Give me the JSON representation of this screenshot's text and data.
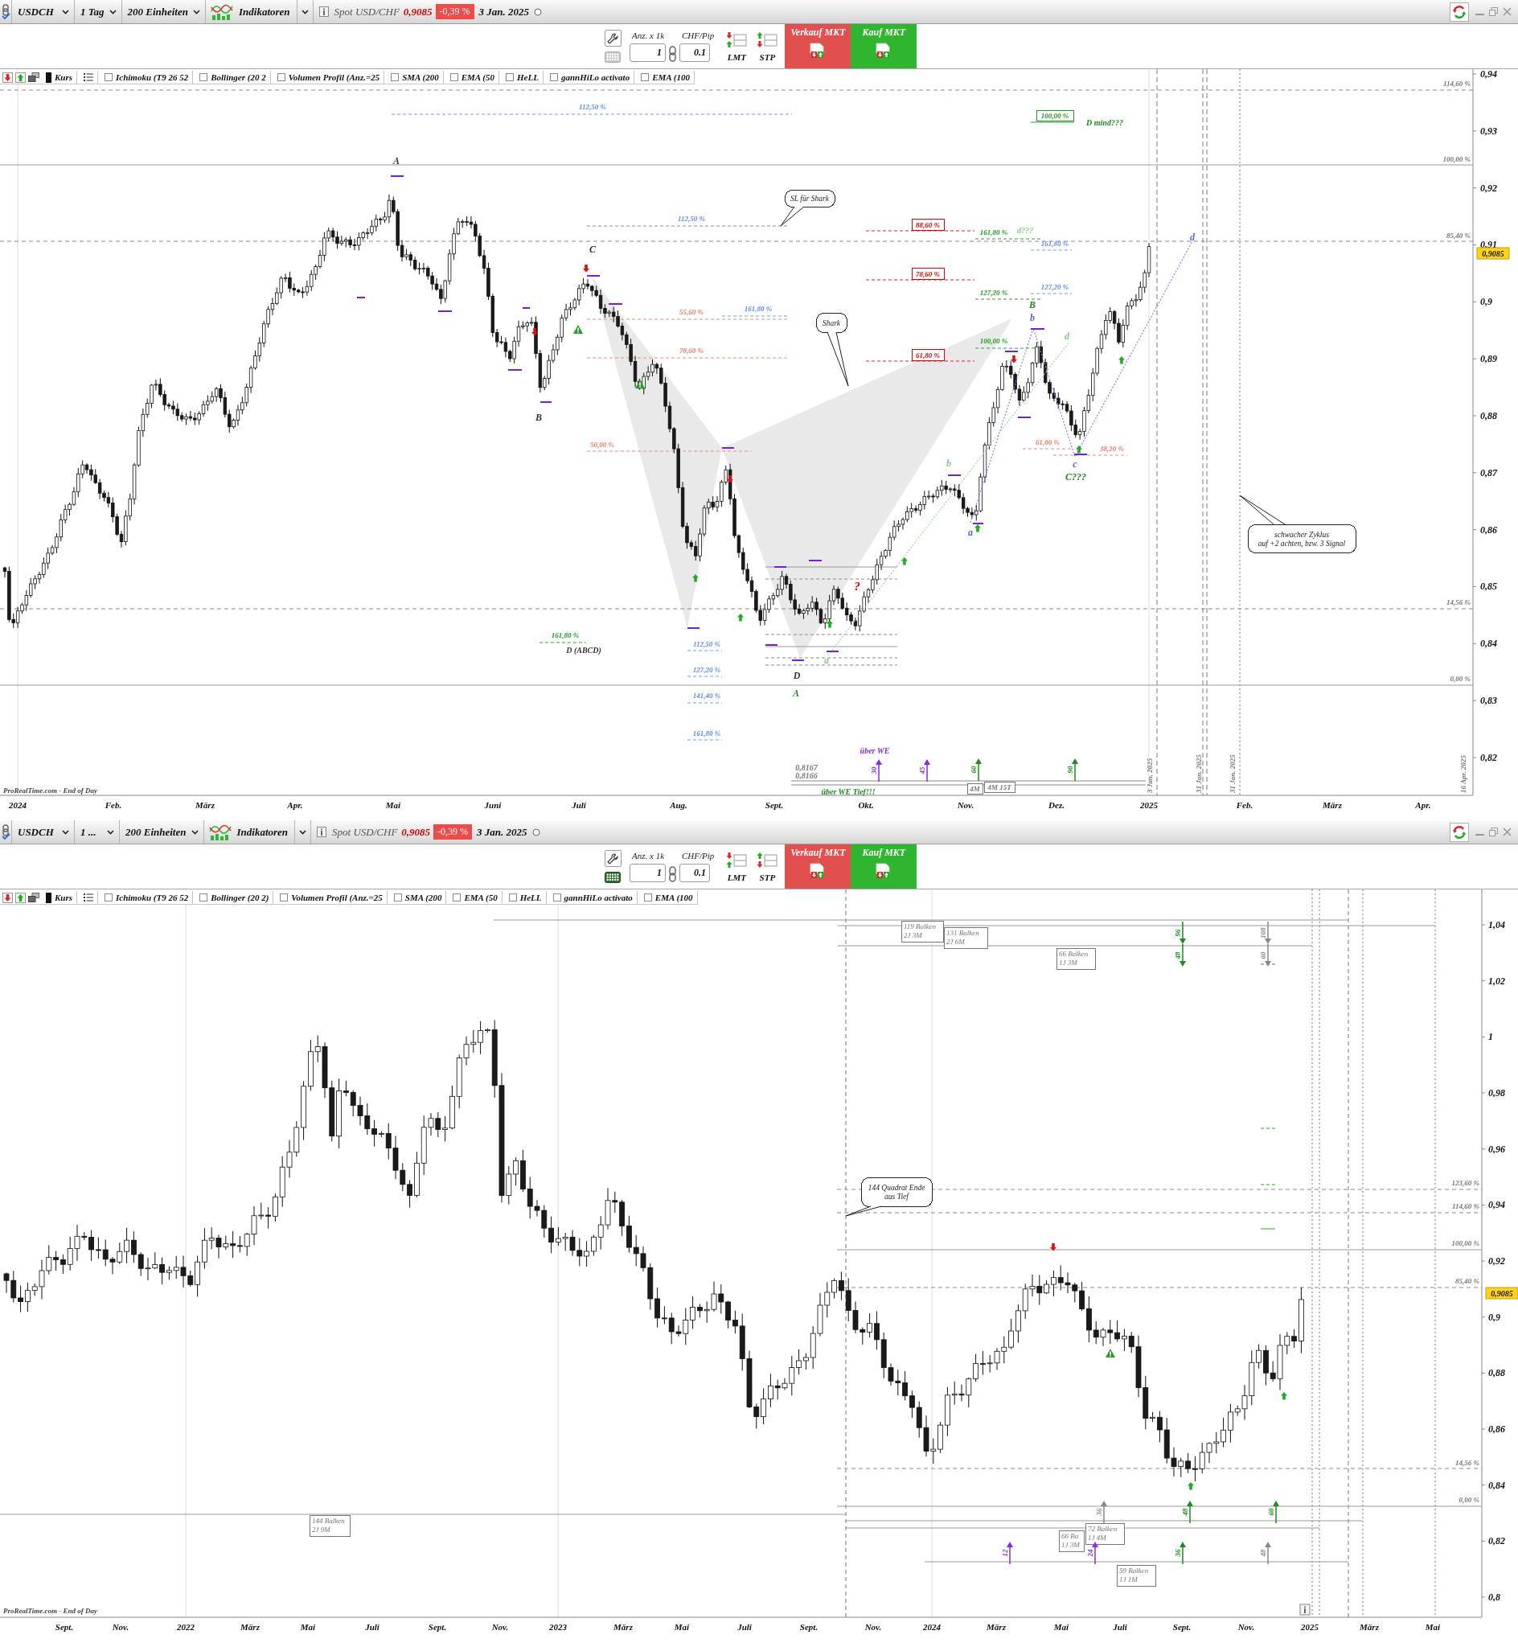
{
  "panels": [
    {
      "toolbar": {
        "symbol": "USDCH",
        "timeframe": "1 Tag",
        "units": "200 Einheiten",
        "indicators_menu": "Indikatoren",
        "instrument": "Spot USD/CHF",
        "price": "0,9085",
        "change": "-0,39 %",
        "date": "3 Jan. 2025"
      },
      "order": {
        "keyboard_active": false,
        "quantity_label": "Anz. x 1k",
        "quantity": "1",
        "pip_label": "CHF/Pip",
        "pip_value": "0.1",
        "limit": "LMT",
        "stop": "STP",
        "sell": "Verkauf MKT",
        "buy": "Kauf MKT"
      },
      "indicators": [
        {
          "kind": "price",
          "label": "Kurs"
        },
        {
          "kind": "check",
          "label": "Ichimoku (T9 26 52",
          "checked": false
        },
        {
          "kind": "check",
          "label": "Bollinger (20 2",
          "checked": false
        },
        {
          "kind": "check",
          "label": "Volumen Profil (Anz.=25",
          "checked": false
        },
        {
          "kind": "check",
          "label": "SMA (200",
          "checked": false
        },
        {
          "kind": "check",
          "label": "EMA (50",
          "checked": false
        },
        {
          "kind": "check",
          "label": "HeLL",
          "checked": false
        },
        {
          "kind": "check",
          "label": "gannHiLo activato",
          "checked": false
        },
        {
          "kind": "check",
          "label": "EMA (100",
          "checked": false
        }
      ],
      "chart": {
        "y_axis": [
          "0,94",
          "0,93",
          "0,92",
          "0,91",
          "0,9",
          "0,89",
          "0,88",
          "0,87",
          "0,86",
          "0,85",
          "0,84",
          "0,83",
          "0,82"
        ],
        "x_axis": [
          "2024",
          "Feb.",
          "März",
          "Apr.",
          "Mai",
          "Juni",
          "Juli",
          "Aug.",
          "Sept.",
          "Okt.",
          "Nov.",
          "Dez.",
          "2025",
          "Feb.",
          "März",
          "Apr."
        ],
        "price_tag": "0,9085",
        "annotations": [
          {
            "kind": "level",
            "text": "112,50 %",
            "color": "#5b8def"
          },
          {
            "kind": "point",
            "text": "A",
            "color": "#333333"
          },
          {
            "kind": "callout",
            "lines": [
              "SL für Shark"
            ],
            "color": "#222222"
          },
          {
            "kind": "level",
            "text": "112,50 %",
            "color": "#5b8def"
          },
          {
            "kind": "point",
            "text": "C",
            "color": "#333333"
          },
          {
            "kind": "boxed",
            "text": "88,60 %",
            "color": "#e00000"
          },
          {
            "kind": "level",
            "text": "161,80 %",
            "color": "#1f9a1f"
          },
          {
            "kind": "note",
            "text": "d???",
            "color": "#8cc98c"
          },
          {
            "kind": "level",
            "text": "161,80 %",
            "color": "#5b8def"
          },
          {
            "kind": "boxed",
            "text": "78,60 %",
            "color": "#e00000"
          },
          {
            "kind": "level",
            "text": "127,20 %",
            "color": "#5b8def"
          },
          {
            "kind": "level",
            "text": "127,20 %",
            "color": "#1f9a1f"
          },
          {
            "kind": "point",
            "text": "B",
            "color": "#1f8a1f"
          },
          {
            "kind": "level",
            "text": "55,60 %",
            "color": "#f07a68"
          },
          {
            "kind": "level",
            "text": "161,80 %",
            "color": "#5b8def"
          },
          {
            "kind": "callout",
            "lines": [
              "Shark"
            ],
            "color": "#222222"
          },
          {
            "kind": "point",
            "text": "b",
            "color": "#5a64d8"
          },
          {
            "kind": "point",
            "text": "d",
            "color": "#8cc98c"
          },
          {
            "kind": "level",
            "text": "100,00 %",
            "color": "#1f9a1f"
          },
          {
            "kind": "level",
            "text": "78,60 %",
            "color": "#f07a68"
          },
          {
            "kind": "boxed",
            "text": "61,80 %",
            "color": "#e00000"
          },
          {
            "kind": "level",
            "text": "50,00 %",
            "color": "#f07a68"
          },
          {
            "kind": "level",
            "text": "61,80 %",
            "color": "#f07a68"
          },
          {
            "kind": "level",
            "text": "38,20 %",
            "color": "#f07a68"
          },
          {
            "kind": "point",
            "text": "c",
            "color": "#5a64d8"
          },
          {
            "kind": "point",
            "text": "C???",
            "color": "#1f8a1f"
          },
          {
            "kind": "point",
            "text": "b",
            "color": "#8cc98c"
          },
          {
            "kind": "point",
            "text": "a",
            "color": "#5a64d8"
          },
          {
            "kind": "boxed",
            "text": "100,00 %",
            "color": "#1f9a1f"
          },
          {
            "kind": "note",
            "text": "D mind???",
            "color": "#1f8a1f"
          },
          {
            "kind": "note",
            "text": "?",
            "color": "#e00000"
          },
          {
            "kind": "level",
            "text": "161,80 %",
            "color": "#1f9a1f"
          },
          {
            "kind": "note",
            "text": "D (ABCD)",
            "color": "#333333"
          },
          {
            "kind": "level",
            "text": "112,50 %",
            "color": "#5b8def"
          },
          {
            "kind": "level",
            "text": "127,20 %",
            "color": "#5b8def"
          },
          {
            "kind": "level",
            "text": "141,40 %",
            "color": "#5b8def"
          },
          {
            "kind": "level",
            "text": "161,80 %",
            "color": "#5b8def"
          },
          {
            "kind": "point",
            "text": "D",
            "color": "#333333"
          },
          {
            "kind": "point",
            "text": "A",
            "color": "#1f8a1f"
          },
          {
            "kind": "point",
            "text": "a",
            "color": "#8cc98c"
          },
          {
            "kind": "note",
            "text": "über WE",
            "color": "#8a2be2"
          },
          {
            "kind": "note",
            "text": "0,8167",
            "color": "#777777"
          },
          {
            "kind": "note",
            "text": "0,8166",
            "color": "#777777"
          },
          {
            "kind": "note",
            "text": "über WE Tief!!!",
            "color": "#1f8a1f"
          },
          {
            "kind": "counter",
            "text": "30",
            "color": "#8a2be2",
            "upward": true
          },
          {
            "kind": "counter",
            "text": "45",
            "color": "#8a2be2",
            "upward": true
          },
          {
            "kind": "counter",
            "text": "60",
            "color": "#1f8a1f",
            "upward": true
          },
          {
            "kind": "counter",
            "text": "90",
            "color": "#1f8a1f",
            "upward": true
          },
          {
            "kind": "boxed",
            "text": "4M",
            "color": "#777777"
          },
          {
            "kind": "boxed",
            "text": "4M 15T",
            "color": "#777777"
          },
          {
            "kind": "vertical",
            "text": "3 Jan. 2025",
            "color": "#777777"
          },
          {
            "kind": "vertical",
            "text": "31 Jan. 2025",
            "color": "#777777"
          },
          {
            "kind": "vertical",
            "text": "31 Jan. 2025",
            "color": "#777777"
          },
          {
            "kind": "vertical",
            "text": "16 Apr. 2025",
            "color": "#777777"
          },
          {
            "kind": "axislevel",
            "text": "114,60 %",
            "color": "#777777"
          },
          {
            "kind": "axislevel",
            "text": "100,00 %",
            "color": "#777777"
          },
          {
            "kind": "axislevel",
            "text": "85,40 %",
            "color": "#777777"
          },
          {
            "kind": "axislevel",
            "text": "14,56 %",
            "color": "#777777"
          },
          {
            "kind": "axislevel",
            "text": "0,00 %",
            "color": "#777777"
          },
          {
            "kind": "callout",
            "lines": [
              "schwacher Zyklus",
              "auf +2 achten, bzw. 3 Signal"
            ],
            "color": "#222222"
          },
          {
            "kind": "point",
            "text": "B",
            "color": "#333333"
          },
          {
            "kind": "point",
            "text": "d",
            "color": "#5a64d8"
          },
          {
            "kind": "source",
            "text": "ProRealTime.com - End of Day",
            "color": "#444444"
          }
        ]
      }
    },
    {
      "toolbar": {
        "symbol": "USDCH",
        "timeframe": "1 ...",
        "units": "200 Einheiten",
        "indicators_menu": "Indikatoren",
        "instrument": "Spot USD/CHF",
        "price": "0,9085",
        "change": "-0,39 %",
        "date": "3 Jan. 2025"
      },
      "order": {
        "keyboard_active": true,
        "quantity_label": "Anz. x 1k",
        "quantity": "1",
        "pip_label": "CHF/Pip",
        "pip_value": "0.1",
        "limit": "LMT",
        "stop": "STP",
        "sell": "Verkauf MKT",
        "buy": "Kauf MKT"
      },
      "indicators": [
        {
          "kind": "price",
          "label": "Kurs"
        },
        {
          "kind": "check",
          "label": "Ichimoku (T9 26 52",
          "checked": false
        },
        {
          "kind": "check",
          "label": "Bollinger (20 2)",
          "checked": false
        },
        {
          "kind": "check",
          "label": "Volumen Profil (Anz.=25",
          "checked": false
        },
        {
          "kind": "check",
          "label": "SMA (200",
          "checked": false
        },
        {
          "kind": "check",
          "label": "EMA (50",
          "checked": false
        },
        {
          "kind": "check",
          "label": "HeLL",
          "checked": false
        },
        {
          "kind": "check",
          "label": "gannHiLo activato",
          "checked": false
        },
        {
          "kind": "check",
          "label": "EMA (100",
          "checked": false
        }
      ],
      "chart": {
        "y_axis": [
          "1,04",
          "1,02",
          "1",
          "0,98",
          "0,96",
          "0,94",
          "0,92",
          "0,9",
          "0,88",
          "0,86",
          "0,84",
          "0,82",
          "0,8"
        ],
        "x_axis": [
          "Sept.",
          "Nov.",
          "2022",
          "März",
          "Mai",
          "Juli",
          "Sept.",
          "Nov.",
          "2023",
          "März",
          "Mai",
          "Juli",
          "Sept.",
          "Nov.",
          "2024",
          "März",
          "Mai",
          "Juli",
          "Sept.",
          "Nov.",
          "2025",
          "März",
          "Mai"
        ],
        "price_tag": "0,9085",
        "annotations": [
          {
            "kind": "box",
            "lines": [
              "119 Balken",
              "2J 3M"
            ],
            "color": "#777777"
          },
          {
            "kind": "box",
            "lines": [
              "131 Balken",
              "2J 6M"
            ],
            "color": "#777777"
          },
          {
            "kind": "box",
            "lines": [
              "66 Balken",
              "1J 3M"
            ],
            "color": "#777777"
          },
          {
            "kind": "counter",
            "text": "96",
            "color": "#1f8a1f",
            "upward": false
          },
          {
            "kind": "counter",
            "text": "108",
            "color": "#888888",
            "upward": false
          },
          {
            "kind": "counter",
            "text": "48",
            "color": "#1f8a1f",
            "upward": false
          },
          {
            "kind": "counter",
            "text": "60",
            "color": "#888888",
            "upward": false
          },
          {
            "kind": "callout",
            "lines": [
              "144 Quadrat Ende",
              "aus Tief"
            ],
            "color": "#222222"
          },
          {
            "kind": "axislevel",
            "text": "123,60 %",
            "color": "#777777"
          },
          {
            "kind": "axislevel",
            "text": "114,60 %",
            "color": "#777777"
          },
          {
            "kind": "axislevel",
            "text": "100,00 %",
            "color": "#777777"
          },
          {
            "kind": "axislevel",
            "text": "85,40 %",
            "color": "#777777"
          },
          {
            "kind": "axislevel",
            "text": "14,56 %",
            "color": "#777777"
          },
          {
            "kind": "axislevel",
            "text": "0,00 %",
            "color": "#777777"
          },
          {
            "kind": "counter",
            "text": "36",
            "color": "#888888",
            "upward": true
          },
          {
            "kind": "counter",
            "text": "48",
            "color": "#1f8a1f",
            "upward": true
          },
          {
            "kind": "counter",
            "text": "60",
            "color": "#1f8a1f",
            "upward": true
          },
          {
            "kind": "box",
            "lines": [
              "144 Balken",
              "2J 9M"
            ],
            "color": "#777777"
          },
          {
            "kind": "box",
            "lines": [
              "66 Ba",
              "1J 3M"
            ],
            "color": "#777777"
          },
          {
            "kind": "box",
            "lines": [
              "72 Balken",
              "1J 4M"
            ],
            "color": "#777777"
          },
          {
            "kind": "counter",
            "text": "12",
            "color": "#8a2be2",
            "upward": true
          },
          {
            "kind": "counter",
            "text": "24",
            "color": "#8a2be2",
            "upward": true
          },
          {
            "kind": "counter",
            "text": "36",
            "color": "#1f8a1f",
            "upward": true
          },
          {
            "kind": "counter",
            "text": "48",
            "color": "#888888",
            "upward": true
          },
          {
            "kind": "box",
            "lines": [
              "59 Balken",
              "1J 1M"
            ],
            "color": "#777777"
          },
          {
            "kind": "source",
            "text": "ProRealTime.com - End of Day",
            "color": "#444444"
          }
        ]
      }
    }
  ]
}
